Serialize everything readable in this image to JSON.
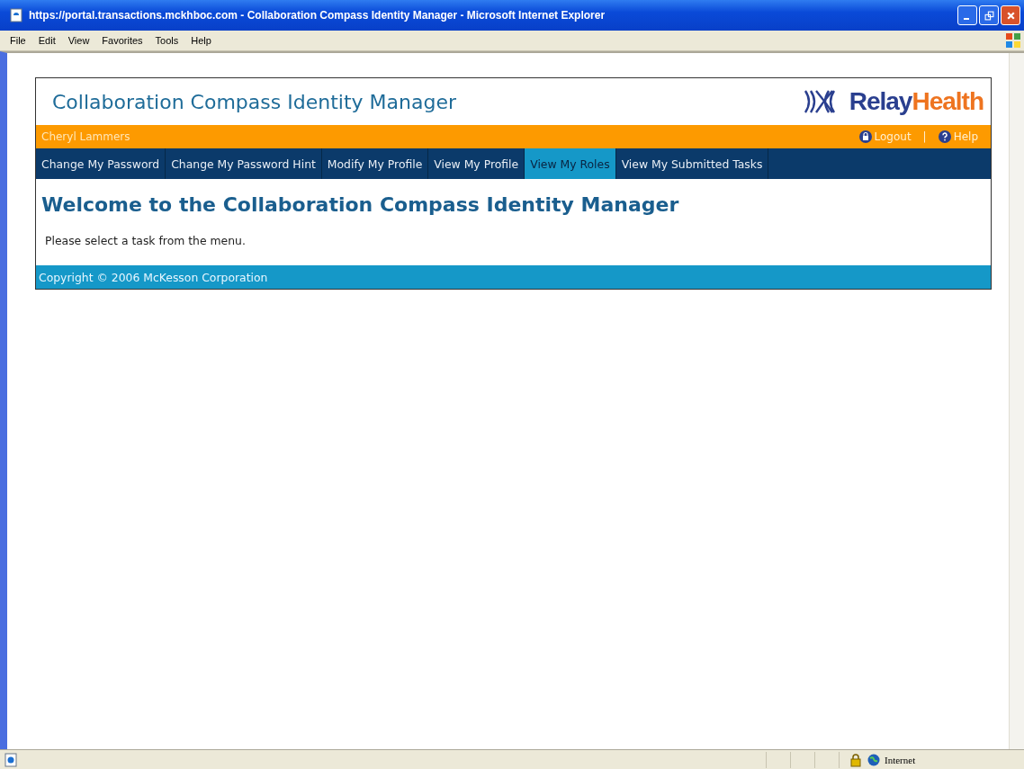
{
  "window": {
    "title": "https://portal.transactions.mckhboc.com - Collaboration Compass Identity Manager - Microsoft Internet Explorer"
  },
  "menu_bar": [
    "File",
    "Edit",
    "View",
    "Favorites",
    "Tools",
    "Help"
  ],
  "page": {
    "app_title": "Collaboration Compass Identity Manager",
    "logo": {
      "first": "Relay",
      "second": "Health"
    },
    "user_name": "Cheryl Lammers",
    "links": [
      {
        "kind": "logout",
        "label": "Logout"
      },
      {
        "kind": "help",
        "label": "Help"
      }
    ],
    "link_separator": "|",
    "nav": [
      {
        "label": "Change My Password",
        "selected": false
      },
      {
        "label": "Change My Password Hint",
        "selected": false
      },
      {
        "label": "Modify My Profile",
        "selected": false
      },
      {
        "label": "View My Profile",
        "selected": false
      },
      {
        "label": "View My Roles",
        "selected": true
      },
      {
        "label": "View My Submitted Tasks",
        "selected": false
      }
    ],
    "heading": "Welcome to the Collaboration Compass Identity Manager",
    "message": "Please select a task from the menu.",
    "footer": "Copyright © 2006 McKesson Corporation"
  },
  "status_bar": {
    "zone": "Internet"
  }
}
